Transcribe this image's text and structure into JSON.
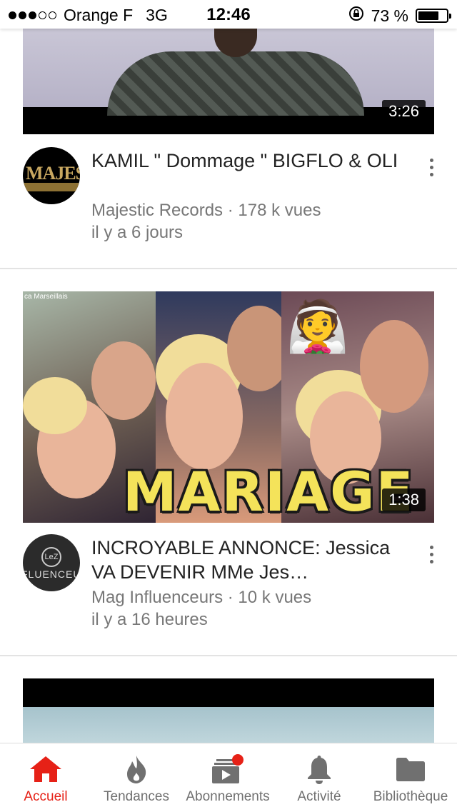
{
  "status_bar": {
    "signal_dots": [
      true,
      true,
      true,
      false,
      false
    ],
    "carrier": "Orange F",
    "network": "3G",
    "time": "12:46",
    "battery_percent": "73 %",
    "battery_level": 0.73
  },
  "videos": [
    {
      "title": "KAMIL \" Dommage \" BIGFLO & OLI",
      "channel_views": "Majestic Records · 178 k vues",
      "age": "il y a 6 jours",
      "duration": "3:26",
      "avatar_text": "MAJES"
    },
    {
      "title": "INCROYABLE ANNONCE: Jessica VA DEVENIR MMe Jes…",
      "channel_views": "Mag Influenceurs · 10 k vues",
      "age": "il y a 16 heures",
      "duration": "1:38",
      "thumb_text": "MARIAGE",
      "thumb_tag": "ca Marseillais",
      "avatar_text": "FLUENCEU",
      "avatar_logo": "LeZ"
    }
  ],
  "tabs": [
    {
      "label": "Accueil",
      "icon": "home-icon",
      "active": true
    },
    {
      "label": "Tendances",
      "icon": "flame-icon",
      "active": false
    },
    {
      "label": "Abonnements",
      "icon": "subscriptions-icon",
      "active": false
    },
    {
      "label": "Activité",
      "icon": "bell-icon",
      "active": false
    },
    {
      "label": "Bibliothèque",
      "icon": "folder-icon",
      "active": false
    }
  ],
  "colors": {
    "accent": "#e62117",
    "inactive": "#707070",
    "meta_text": "#777777"
  }
}
